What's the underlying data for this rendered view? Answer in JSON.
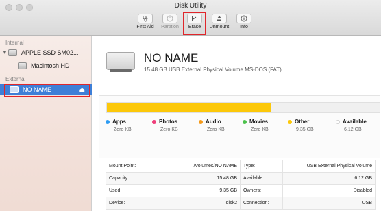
{
  "window": {
    "title": "Disk Utility"
  },
  "toolbar": {
    "items": [
      {
        "label": "First Aid",
        "icon": "stethoscope-icon",
        "enabled": true
      },
      {
        "label": "Partition",
        "icon": "partition-icon",
        "enabled": false
      },
      {
        "label": "Erase",
        "icon": "erase-icon",
        "enabled": true,
        "highlighted": true
      },
      {
        "label": "Unmount",
        "icon": "unmount-icon",
        "enabled": true
      },
      {
        "label": "Info",
        "icon": "info-icon",
        "enabled": true
      }
    ]
  },
  "sidebar": {
    "internal_header": "Internal",
    "external_header": "External",
    "internal": [
      {
        "name": "APPLE SSD SM02...",
        "expanded": true
      },
      {
        "name": "Macintosh HD"
      }
    ],
    "external": [
      {
        "name": "NO NAME",
        "selected": true,
        "eject": "⏏"
      }
    ]
  },
  "volume": {
    "name": "NO NAME",
    "description": "15.48 GB USB External Physical Volume MS-DOS (FAT)",
    "used_fraction": 0.6
  },
  "usage": [
    {
      "label": "Apps",
      "value": "Zero KB",
      "color": "#2d9cf3"
    },
    {
      "label": "Photos",
      "value": "Zero KB",
      "color": "#ef3f7b"
    },
    {
      "label": "Audio",
      "value": "Zero KB",
      "color": "#f59a18"
    },
    {
      "label": "Movies",
      "value": "Zero KB",
      "color": "#4cc24c"
    },
    {
      "label": "Other",
      "value": "9.35 GB",
      "color": "#fcc80a"
    },
    {
      "label": "Available",
      "value": "6.12 GB",
      "color": "#ffffff"
    }
  ],
  "info": {
    "rows": [
      {
        "k1": "Mount Point:",
        "v1": "/Volumes/NO NAME",
        "k2": "Type:",
        "v2": "USB External Physical Volume"
      },
      {
        "k1": "Capacity:",
        "v1": "15.48 GB",
        "k2": "Available:",
        "v2": "6.12 GB"
      },
      {
        "k1": "Used:",
        "v1": "9.35 GB",
        "k2": "Owners:",
        "v2": "Disabled"
      },
      {
        "k1": "Device:",
        "v1": "disk2",
        "k2": "Connection:",
        "v2": "USB"
      }
    ]
  }
}
